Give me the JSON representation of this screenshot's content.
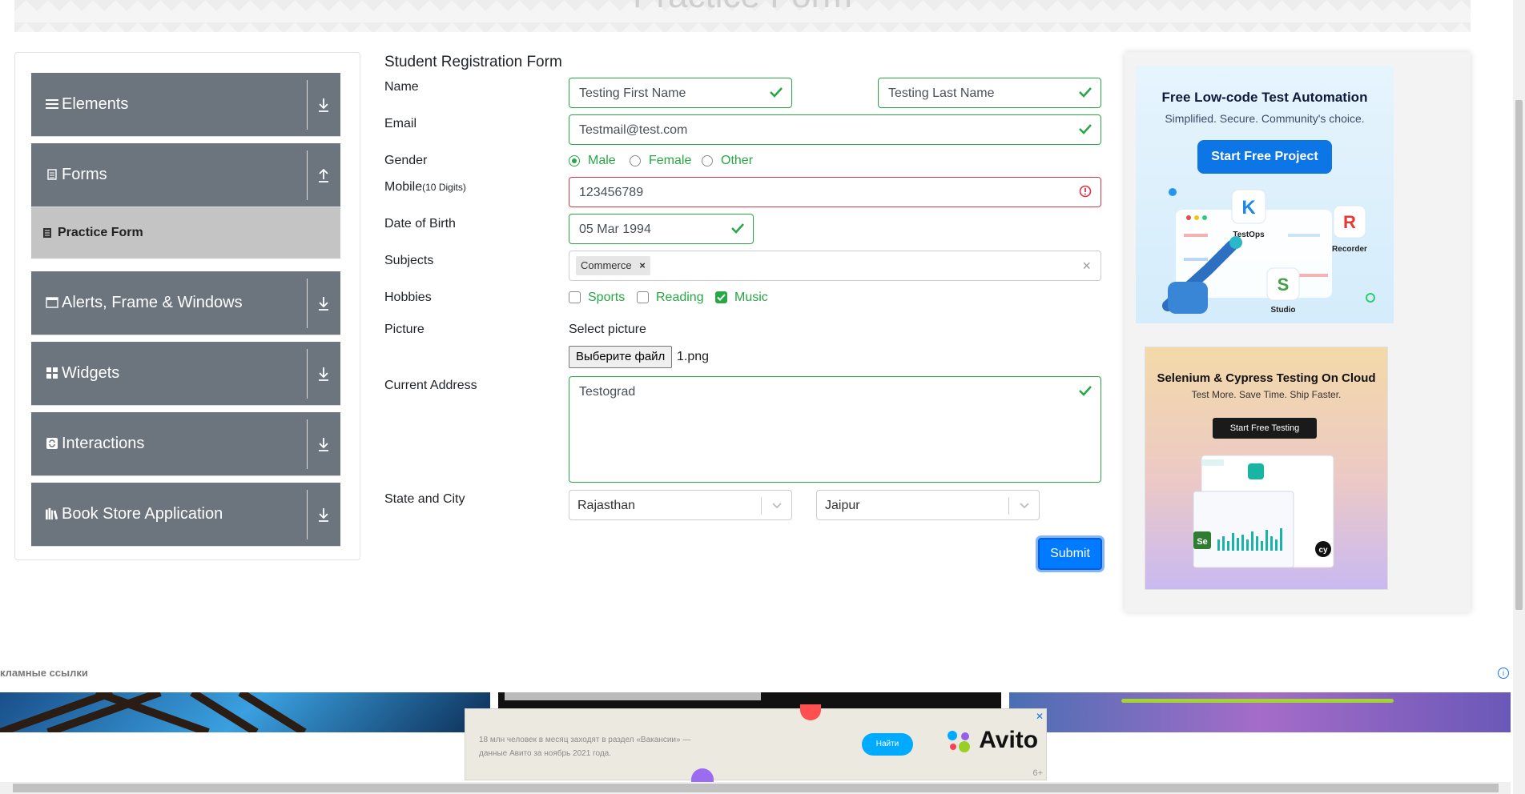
{
  "top_banner": {
    "title": "Practice Form"
  },
  "menu": {
    "groups": [
      {
        "label": "Elements",
        "icon": "hamburger-icon",
        "arrow": "download-arrow-icon"
      },
      {
        "label": "Forms",
        "icon": "document-icon",
        "arrow": "upload-arrow-icon"
      },
      {
        "label": "Alerts, Frame & Windows",
        "icon": "window-icon",
        "arrow": "download-arrow-icon"
      },
      {
        "label": "Widgets",
        "icon": "grid-icon",
        "arrow": "download-arrow-icon"
      },
      {
        "label": "Interactions",
        "icon": "sync-icon",
        "arrow": "download-arrow-icon"
      },
      {
        "label": "Book Store Application",
        "icon": "books-icon",
        "arrow": "download-arrow-icon"
      }
    ],
    "active_item": "Practice Form"
  },
  "form": {
    "title": "Student Registration Form",
    "labels": {
      "name": "Name",
      "email": "Email",
      "gender": "Gender",
      "mobile": "Mobile",
      "mobile_hint": "(10 Digits)",
      "dob": "Date of Birth",
      "subjects": "Subjects",
      "hobbies": "Hobbies",
      "picture": "Picture",
      "address": "Current Address",
      "state_city": "State and City"
    },
    "first_name": "Testing First Name",
    "last_name": "Testing Last Name",
    "email": "Testmail@test.com",
    "gender_options": [
      "Male",
      "Female",
      "Other"
    ],
    "gender_selected": "Male",
    "mobile": "123456789",
    "dob": "05 Mar 1994",
    "subject_tag": "Commerce",
    "subject_tag_remove": "×",
    "subjects_clear": "×",
    "hobbies": [
      "Sports",
      "Reading",
      "Music"
    ],
    "hobbies_checked": [
      "Music"
    ],
    "picture_caption": "Select picture",
    "file_button": "Выберите файл",
    "file_name": "1.png",
    "address": "Testograd",
    "state": "Rajasthan",
    "city": "Jaipur",
    "submit": "Submit"
  },
  "ads": {
    "ad1": {
      "title": "Free Low-code Test Automation",
      "subtitle": "Simplified. Secure. Community's choice.",
      "button": "Start Free Project",
      "labels": [
        "TestOps",
        "Recorder",
        "Studio"
      ]
    },
    "ad2": {
      "title": "Selenium & Cypress Testing On Cloud",
      "subtitle": "Test More. Save Time. Ship Faster.",
      "button": "Start Free Testing"
    }
  },
  "bottom": {
    "ads_links_label": "кламные ссылки",
    "info": "i",
    "avito": {
      "text": "18 млн человек в месяц заходят в раздел «Вакансии» — данные Авито за ноябрь 2021 года.",
      "button": "Найти",
      "logo": "Avito",
      "age": "6+",
      "close": "✕"
    }
  },
  "colors": {
    "menu_bg": "#6c757d",
    "active_item_bg": "#c4c4c4",
    "valid": "#28a745",
    "invalid": "#dc3545",
    "primary": "#007bff"
  }
}
